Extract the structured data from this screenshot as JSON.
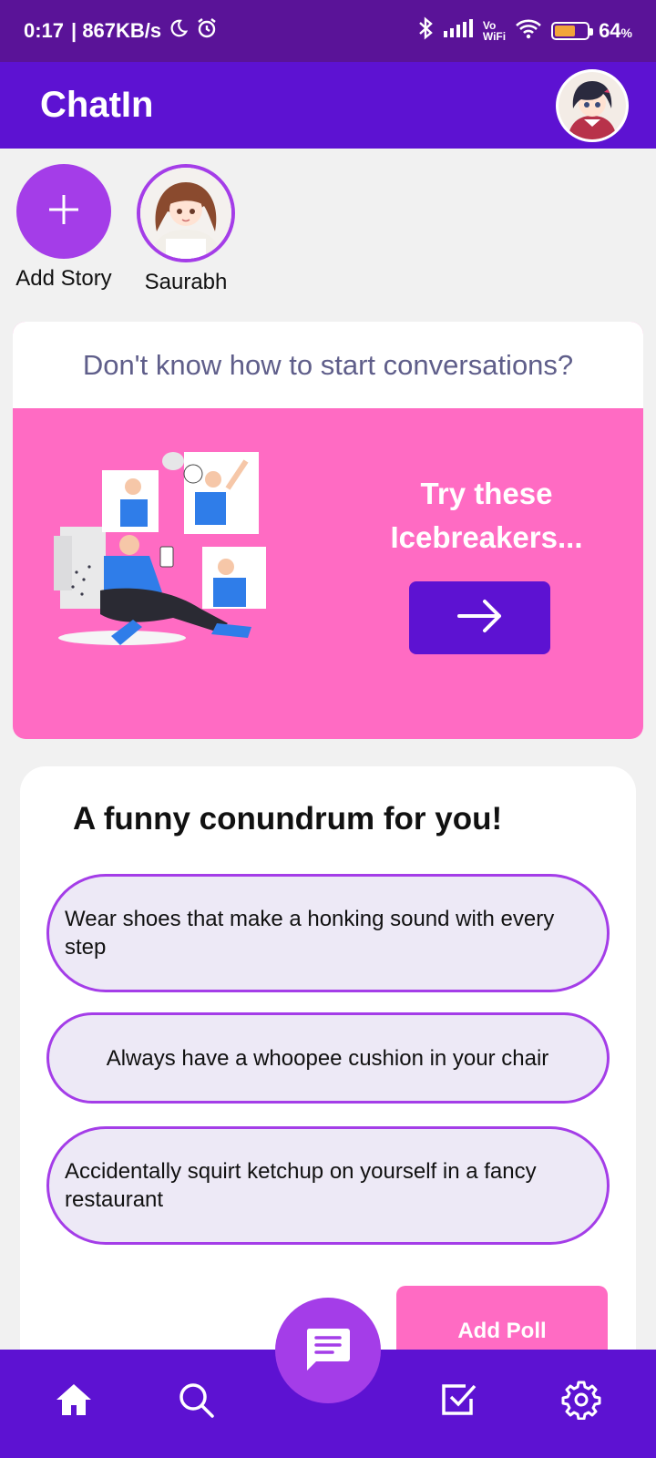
{
  "status_bar": {
    "time": "0:17",
    "speed": "| 867KB/s",
    "vowifi_top": "Vo",
    "vowifi_bottom": "WiFi",
    "battery_percent": "64",
    "battery_pct_sign": "%",
    "battery_level": 0.64,
    "icons": [
      "moon-icon",
      "alarm-icon",
      "bluetooth-icon",
      "signal-icon",
      "wifi-icon",
      "battery-icon"
    ]
  },
  "app_bar": {
    "title": "ChatIn"
  },
  "stories": {
    "add_label": "Add Story",
    "items": [
      {
        "label": "Saurabh"
      }
    ]
  },
  "icebreaker": {
    "heading": "Don't know how to start conversations?",
    "line1": "Try these",
    "line2": "Icebreakers..."
  },
  "poll": {
    "title": "A funny conundrum for you!",
    "options": [
      "Wear shoes that make a honking sound with every step",
      "Always have a whoopee cushion in your chair",
      "Accidentally squirt ketchup on yourself in a fancy restaurant"
    ],
    "add_poll_label": "Add Poll"
  },
  "bottom_nav": {
    "items": [
      "home-icon",
      "search-icon",
      "chat-icon",
      "tasks-icon",
      "settings-icon"
    ]
  },
  "colors": {
    "status_bar": "#5a1398",
    "primary": "#5d12d2",
    "accent_purple": "#a43de8",
    "pink": "#ff6bc3",
    "option_bg": "#ede9f6"
  }
}
